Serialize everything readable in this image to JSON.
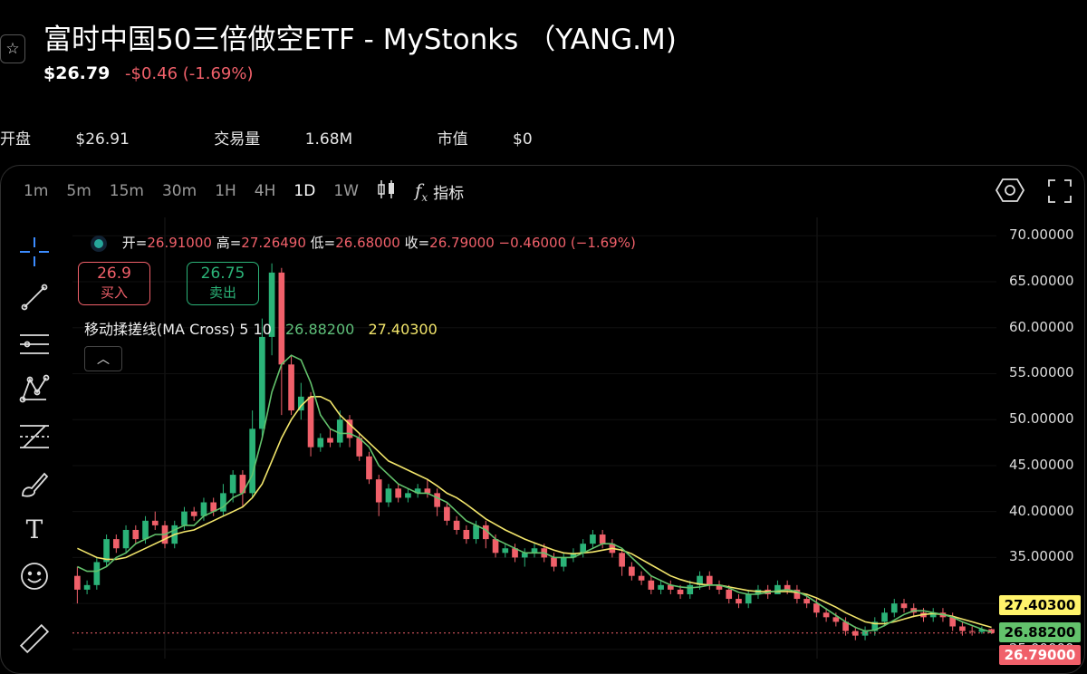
{
  "header": {
    "title": "富时中国50三倍做空ETF - MyStonks （YANG.M)",
    "price": "$26.79",
    "change": "-$0.46 (-1.69%)"
  },
  "stats": [
    {
      "label": "开盘",
      "value": "$26.91"
    },
    {
      "label": "交易量",
      "value": "1.68M"
    },
    {
      "label": "市值",
      "value": "$0"
    }
  ],
  "intervals": [
    "1m",
    "5m",
    "15m",
    "30m",
    "1H",
    "4H",
    "1D",
    "1W"
  ],
  "active_interval": "1D",
  "indicator_label": "指标",
  "ohlc": {
    "open_label": "开=",
    "open": "26.91000",
    "high_label": "高=",
    "high": "27.26490",
    "low_label": "低=",
    "low": "26.68000",
    "close_label": "收=",
    "close": "26.79000",
    "change": "−0.46000 (−1.69%)"
  },
  "buy": {
    "price": "26.9",
    "label": "买入"
  },
  "sell": {
    "price": "26.75",
    "label": "卖出"
  },
  "ma_legend": {
    "name": "移动揉搓线(MA Cross)",
    "params": "5 10",
    "ma5": "26.88200",
    "ma10": "27.40300"
  },
  "colors": {
    "up": "#2bb378",
    "down": "#f0606a",
    "ma5": "#63c26c",
    "ma10": "#f2e56b"
  },
  "toolbar_icons": [
    "crosshair-icon",
    "trendline-icon",
    "lines-icon",
    "pattern-icon",
    "fib-icon",
    "brush-icon",
    "text-icon",
    "emoji-icon",
    "ruler-icon"
  ],
  "chart_data": {
    "type": "candlestick",
    "ylim": [
      24,
      72
    ],
    "y_ticks": [
      "70.00000",
      "65.00000",
      "60.00000",
      "55.00000",
      "50.00000",
      "45.00000",
      "40.00000",
      "35.00000",
      "30.00000",
      "25.00000"
    ],
    "y_tick_values": [
      70,
      65,
      60,
      55,
      50,
      45,
      40,
      35,
      30,
      25
    ],
    "price_tags": [
      "27.40300",
      "26.88200",
      "26.79000"
    ],
    "price_tag_values": [
      27.403,
      26.882,
      26.79
    ],
    "candles": [
      [
        33,
        31.5,
        34,
        30
      ],
      [
        31.5,
        32,
        32.5,
        31
      ],
      [
        32,
        34.5,
        35,
        31.5
      ],
      [
        34.5,
        37,
        37.5,
        34
      ],
      [
        37,
        36,
        37.5,
        35.5
      ],
      [
        36,
        38,
        38.5,
        35.5
      ],
      [
        38,
        37,
        38.5,
        36.5
      ],
      [
        37,
        39,
        39.5,
        36.5
      ],
      [
        39,
        38.5,
        40,
        38
      ],
      [
        38.5,
        36.5,
        39,
        36
      ],
      [
        36.5,
        38.5,
        39,
        36
      ],
      [
        38.5,
        40,
        40.5,
        38
      ],
      [
        40,
        39.5,
        40.5,
        39
      ],
      [
        39.5,
        41,
        41.5,
        39
      ],
      [
        41,
        40,
        41.5,
        39.5
      ],
      [
        40,
        42,
        43,
        39.5
      ],
      [
        42,
        44,
        44.5,
        41
      ],
      [
        44,
        42,
        44.5,
        40.5
      ],
      [
        42,
        49,
        51,
        41.5
      ],
      [
        49,
        59,
        61,
        48
      ],
      [
        59,
        66,
        67,
        57
      ],
      [
        66,
        56,
        66.5,
        50.5
      ],
      [
        56,
        51,
        57,
        50.5
      ],
      [
        51,
        52.5,
        54,
        50
      ],
      [
        52.5,
        47,
        53,
        46
      ],
      [
        47,
        48,
        48.5,
        46.5
      ],
      [
        48,
        47.5,
        49,
        47
      ],
      [
        47.5,
        50,
        51,
        47
      ],
      [
        50,
        48,
        50.5,
        47
      ],
      [
        48,
        46,
        48.5,
        45.5
      ],
      [
        46,
        43.5,
        46.5,
        43
      ],
      [
        43.5,
        41,
        44,
        39.5
      ],
      [
        41,
        42.5,
        43,
        40.5
      ],
      [
        42.5,
        41.5,
        43,
        41
      ],
      [
        41.5,
        42,
        42.5,
        41
      ],
      [
        42,
        42.5,
        43,
        41.5
      ],
      [
        42.5,
        42,
        43.5,
        41.5
      ],
      [
        42,
        40.5,
        42.5,
        39.5
      ],
      [
        40.5,
        39,
        41,
        38.5
      ],
      [
        39,
        38,
        39.5,
        37.5
      ],
      [
        38,
        37,
        38.5,
        36.5
      ],
      [
        37,
        38.5,
        39,
        36.5
      ],
      [
        38.5,
        37,
        39,
        36
      ],
      [
        37,
        35.5,
        37.5,
        35
      ],
      [
        35.5,
        36,
        36.5,
        35
      ],
      [
        36,
        35,
        36.5,
        34.5
      ],
      [
        35,
        35.5,
        36,
        34
      ],
      [
        35.5,
        36,
        36.5,
        35
      ],
      [
        36,
        35,
        36.5,
        34.5
      ],
      [
        35,
        34,
        35.5,
        33.5
      ],
      [
        34,
        35,
        35.5,
        33.5
      ],
      [
        35,
        35.5,
        36,
        34.5
      ],
      [
        35.5,
        36.5,
        37,
        35
      ],
      [
        36.5,
        37.5,
        38,
        36
      ],
      [
        37.5,
        36.5,
        38,
        36
      ],
      [
        36.5,
        35.5,
        37,
        35
      ],
      [
        35.5,
        34,
        36,
        33
      ],
      [
        34,
        33,
        34.5,
        32.5
      ],
      [
        33,
        32.5,
        33.5,
        32
      ],
      [
        32.5,
        31.5,
        33,
        31
      ],
      [
        31.5,
        32,
        32.5,
        31
      ],
      [
        32,
        31.5,
        32.5,
        31
      ],
      [
        31.5,
        31,
        32,
        30.5
      ],
      [
        31,
        32,
        32.5,
        30.5
      ],
      [
        32,
        33,
        33.5,
        31.5
      ],
      [
        33,
        32,
        33.5,
        31.5
      ],
      [
        32,
        31.5,
        32.5,
        31
      ],
      [
        31.5,
        30.5,
        32,
        30
      ],
      [
        30.5,
        30,
        31,
        29.5
      ],
      [
        30,
        31,
        31.5,
        29.5
      ],
      [
        31,
        31.5,
        32,
        30.5
      ],
      [
        31.5,
        31,
        32,
        30.5
      ],
      [
        31,
        32,
        32.5,
        31
      ],
      [
        32,
        31.5,
        32.5,
        31
      ],
      [
        31.5,
        30.5,
        32,
        30
      ],
      [
        30.5,
        30,
        31,
        29.5
      ],
      [
        30,
        29,
        30.5,
        28.5
      ],
      [
        29,
        28.5,
        29.5,
        28
      ],
      [
        28.5,
        28,
        29,
        27.5
      ],
      [
        28,
        27,
        28.5,
        26.5
      ],
      [
        27,
        26.5,
        27.5,
        26
      ],
      [
        26.5,
        27,
        27.5,
        26
      ],
      [
        27,
        28,
        28.5,
        26.5
      ],
      [
        28,
        29,
        29.5,
        27.5
      ],
      [
        29,
        30,
        30.5,
        28.5
      ],
      [
        30,
        29.5,
        30.5,
        29
      ],
      [
        29.5,
        29,
        30,
        28.5
      ],
      [
        29,
        28.5,
        29.5,
        28
      ],
      [
        28.5,
        29,
        29.5,
        28
      ],
      [
        29,
        28.5,
        29.5,
        28
      ],
      [
        28.5,
        27.5,
        29,
        27
      ],
      [
        27.5,
        27,
        28,
        26.5
      ],
      [
        27,
        26.9,
        27.5,
        26.5
      ],
      [
        26.9,
        27.2,
        27.5,
        26.7
      ],
      [
        27.2,
        26.79,
        27.26,
        26.68
      ]
    ],
    "ma5": [
      34,
      33.5,
      33.5,
      34,
      35,
      35.5,
      36.5,
      37,
      37.5,
      37.5,
      38,
      38.5,
      38.5,
      39.5,
      40,
      40.5,
      41.5,
      42,
      44,
      48,
      53,
      56,
      57,
      56.5,
      54,
      50.5,
      49,
      48.5,
      48.5,
      48,
      47,
      45,
      44,
      43,
      42.5,
      42,
      42,
      41.5,
      41,
      40,
      39,
      38.5,
      38,
      37,
      36.5,
      36,
      35.5,
      35.5,
      35.5,
      35,
      35,
      35,
      35.5,
      36,
      36.5,
      36.5,
      36,
      35,
      34,
      33,
      32.5,
      32,
      31.8,
      31.7,
      31.8,
      32,
      32,
      31.7,
      31.2,
      31,
      31,
      31.2,
      31.4,
      31.5,
      31.3,
      30.8,
      30.1,
      29.4,
      28.7,
      28,
      27.4,
      27,
      27.1,
      27.6,
      28.2,
      28.8,
      29.2,
      29.2,
      29,
      28.8,
      28.5,
      28,
      27.6,
      27.2,
      26.88
    ],
    "ma10": [
      36,
      35.5,
      35,
      34.8,
      34.8,
      35,
      35.5,
      36,
      36.5,
      37,
      37.5,
      37.8,
      38,
      38.5,
      39,
      39.5,
      40,
      40.5,
      41.5,
      43,
      45.5,
      48,
      50,
      51.5,
      52.5,
      52.5,
      52,
      50.5,
      49.5,
      48.5,
      47.5,
      46.5,
      45.5,
      45,
      44.5,
      44,
      43.5,
      42.8,
      42,
      41.5,
      40.8,
      40,
      39.2,
      38.6,
      38,
      37.5,
      37,
      36.6,
      36.2,
      35.8,
      35.5,
      35.4,
      35.5,
      35.6,
      35.8,
      36,
      35.8,
      35.4,
      34.8,
      34.2,
      33.6,
      33,
      32.6,
      32.3,
      32.1,
      32,
      32,
      31.8,
      31.6,
      31.4,
      31.3,
      31.3,
      31.3,
      31.3,
      31.2,
      31,
      30.6,
      30.1,
      29.6,
      29,
      28.5,
      28,
      27.8,
      27.8,
      28,
      28.3,
      28.6,
      28.8,
      28.9,
      28.8,
      28.6,
      28.3,
      28,
      27.7,
      27.403
    ]
  }
}
